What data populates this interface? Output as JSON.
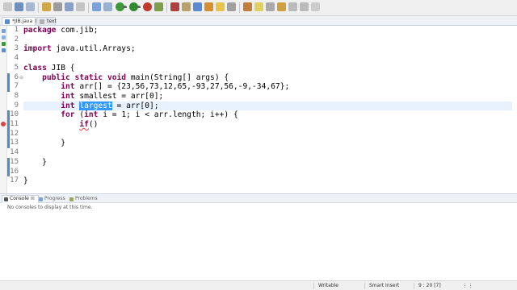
{
  "editor": {
    "tabs": [
      {
        "label": "*JIB.java",
        "close": "⊠",
        "active": true
      },
      {
        "label": "text",
        "close": "",
        "active": false
      }
    ],
    "lines": [
      {
        "n": "1",
        "fold": ""
      },
      {
        "n": "2",
        "fold": ""
      },
      {
        "n": "3",
        "fold": ""
      },
      {
        "n": "4",
        "fold": ""
      },
      {
        "n": "5",
        "fold": ""
      },
      {
        "n": "6",
        "fold": "⊖"
      },
      {
        "n": "7",
        "fold": ""
      },
      {
        "n": "8",
        "fold": ""
      },
      {
        "n": "9",
        "fold": ""
      },
      {
        "n": "10",
        "fold": ""
      },
      {
        "n": "11",
        "fold": ""
      },
      {
        "n": "12",
        "fold": ""
      },
      {
        "n": "13",
        "fold": ""
      },
      {
        "n": "14",
        "fold": ""
      },
      {
        "n": "15",
        "fold": ""
      },
      {
        "n": "16",
        "fold": ""
      },
      {
        "n": "17",
        "fold": ""
      }
    ],
    "code": {
      "l1_kw": "package",
      "l1_rest": " com.jib;",
      "l3_kw": "import",
      "l3_rest": " java.util.Arrays;",
      "l5_kw": "class",
      "l5_rest": " JIB {",
      "l6_indent": "    ",
      "l6_kw": "public static void",
      "l6_rest": " main(String[] args) {",
      "l7_indent": "        ",
      "l7_kw": "int",
      "l7_rest": " arr[] = {23,56,73,12,65,-93,27,56,-9,-34,67};",
      "l8_indent": "        ",
      "l8_kw": "int",
      "l8_rest": " smallest = arr[0];",
      "l9_indent": "        ",
      "l9_kw": "int",
      "l9_space": " ",
      "l9_sel": "largest",
      "l9_rest": " = arr[0];",
      "l10_indent": "        ",
      "l10_kw": "for",
      "l10_mid": " (",
      "l10_kw2": "int",
      "l10_rest": " i = 1; i < arr.length; i++) {",
      "l11_indent": "            ",
      "l11_kw": "if",
      "l11_rest": "()",
      "l13": "        }",
      "l15": "    }",
      "l17": "}"
    }
  },
  "bottom_panel": {
    "tabs": [
      {
        "label": "Console",
        "close": "⊠"
      },
      {
        "label": "Progress"
      },
      {
        "label": "Problems"
      }
    ],
    "message": "No consoles to display at this time."
  },
  "status_bar": {
    "mode": "Writable",
    "insert": "Smart Insert",
    "position": "9 : 20 [7]"
  },
  "colors": {
    "keyword": "#7f0055",
    "selection": "#3399ff",
    "current_line": "#e8f2fe",
    "line_number": "#787878"
  }
}
